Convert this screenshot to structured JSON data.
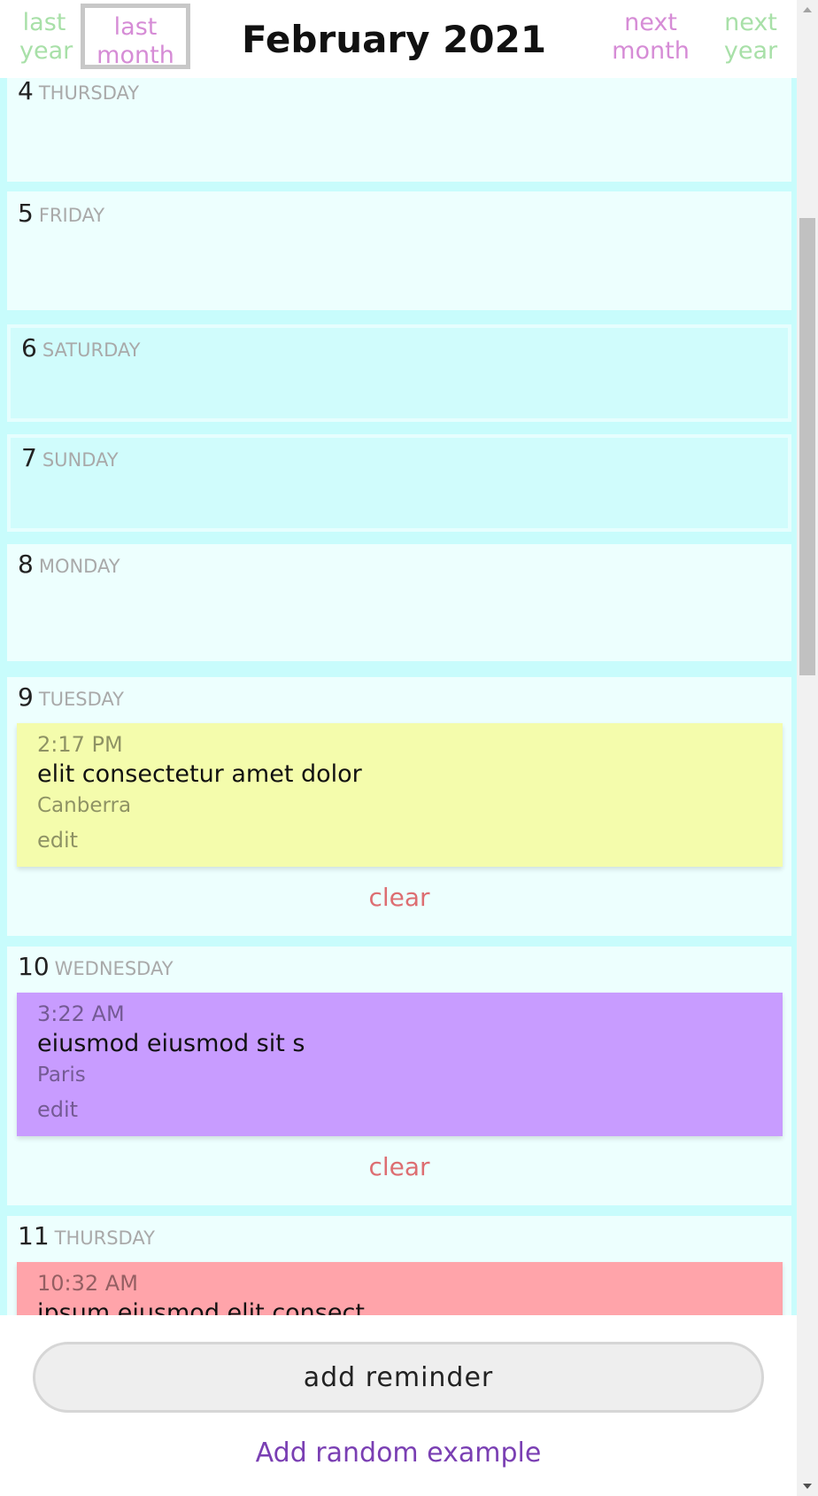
{
  "header": {
    "last_year": "last year",
    "last_month": "last month",
    "title": "February 2021",
    "next_month": "next month",
    "next_year": "next year"
  },
  "days": [
    {
      "num": "4",
      "name": "THURSDAY"
    },
    {
      "num": "5",
      "name": "FRIDAY"
    },
    {
      "num": "6",
      "name": "SATURDAY"
    },
    {
      "num": "7",
      "name": "SUNDAY"
    },
    {
      "num": "8",
      "name": "MONDAY"
    },
    {
      "num": "9",
      "name": "TUESDAY",
      "reminder": {
        "time": "2:17 PM",
        "text": "elit consectetur amet dolor",
        "city": "Canberra",
        "edit": "edit",
        "color": "#f4fcac"
      },
      "clear": "clear"
    },
    {
      "num": "10",
      "name": "WEDNESDAY",
      "reminder": {
        "time": "3:22 AM",
        "text": "eiusmod eiusmod sit s",
        "city": "Paris",
        "edit": "edit",
        "color": "#c89cff"
      },
      "clear": "clear"
    },
    {
      "num": "11",
      "name": "THURSDAY",
      "reminder": {
        "time": "10:32 AM",
        "text": "ipsum eiusmod elit consect",
        "color": "#ffa4aa"
      }
    }
  ],
  "footer": {
    "add_reminder": "add reminder",
    "add_random": "Add random example"
  },
  "colors": {
    "nav_year": "#a8e0a8",
    "nav_month": "#d68cd6",
    "clear": "#dd6e72",
    "add_random": "#7a3fb3",
    "day_bg": "#edfffe",
    "weekend_bg": "#d0fcfc"
  }
}
